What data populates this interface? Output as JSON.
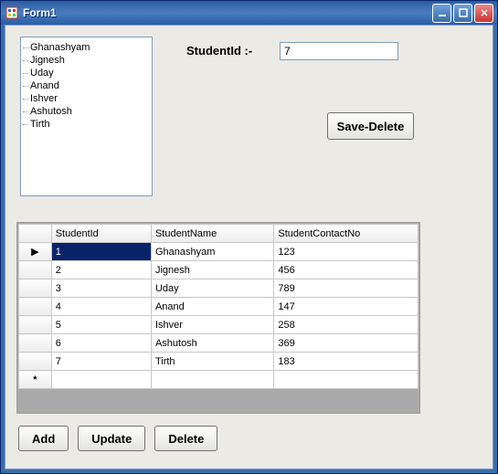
{
  "window": {
    "title": "Form1"
  },
  "form": {
    "studentid_label": "StudentId  :-",
    "studentid_value": "7"
  },
  "tree": {
    "items": [
      "Ghanashyam",
      "Jignesh",
      "Uday",
      "Anand",
      "Ishver",
      "Ashutosh",
      "Tirth"
    ]
  },
  "buttons": {
    "savedelete": "Save-Delete",
    "add": "Add",
    "update": "Update",
    "delete": "Delete"
  },
  "grid": {
    "headers": [
      "StudentId",
      "StudentName",
      "StudentContactNo"
    ],
    "row_indicator": "▶",
    "new_row_indicator": "*",
    "selected_cell": {
      "row": 0,
      "col": 0
    },
    "rows": [
      {
        "id": "1",
        "name": "Ghanashyam",
        "contact": "123"
      },
      {
        "id": "2",
        "name": "Jignesh",
        "contact": "456"
      },
      {
        "id": "3",
        "name": "Uday",
        "contact": "789"
      },
      {
        "id": "4",
        "name": "Anand",
        "contact": "147"
      },
      {
        "id": "5",
        "name": "Ishver",
        "contact": "258"
      },
      {
        "id": "6",
        "name": "Ashutosh",
        "contact": "369"
      },
      {
        "id": "7",
        "name": "Tirth",
        "contact": "183"
      }
    ]
  }
}
